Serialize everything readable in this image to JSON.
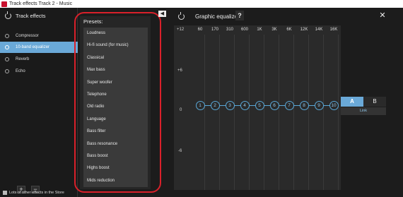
{
  "window": {
    "title": "Track effects  Track 2 - Music"
  },
  "left_panel": {
    "header": "Track effects",
    "effects": [
      "Compressor",
      "10-band equalizer",
      "Reverb",
      "Echo"
    ],
    "active_index": 1,
    "add_label": "+",
    "remove_label": "−",
    "store_link": "Lots of other effects in the Store"
  },
  "presets": {
    "title": "Presets:",
    "items": [
      "Loudness",
      "Hi-fi sound (for music)",
      "Classical",
      "Max bass",
      "Super woofer",
      "Telephone",
      "Old radio",
      "Language",
      "Bass filter",
      "Bass resonance",
      "Bass boost",
      "Highs boost",
      "Mids reduction"
    ]
  },
  "equalizer": {
    "title": "Graphic equalizer",
    "help_label": "?",
    "close_label": "✕",
    "collapse_label": "◀",
    "db_labels": [
      "+12",
      "+6",
      "0",
      "-6"
    ],
    "frequencies": [
      "60",
      "170",
      "310",
      "600",
      "1K",
      "3K",
      "6K",
      "12K",
      "14K",
      "16K"
    ],
    "band_numbers": [
      "1",
      "2",
      "3",
      "4",
      "5",
      "6",
      "7",
      "8",
      "9",
      "10"
    ],
    "band_gains_db": [
      0,
      0,
      0,
      0,
      0,
      0,
      0,
      0,
      0,
      0
    ]
  },
  "ab_compare": {
    "a_label": "A",
    "b_label": "B",
    "link_label": "Link",
    "active": "A"
  },
  "colors": {
    "accent": "#6aa9d8",
    "highlight_ring": "#d9202a",
    "background": "#1c1c1c"
  }
}
